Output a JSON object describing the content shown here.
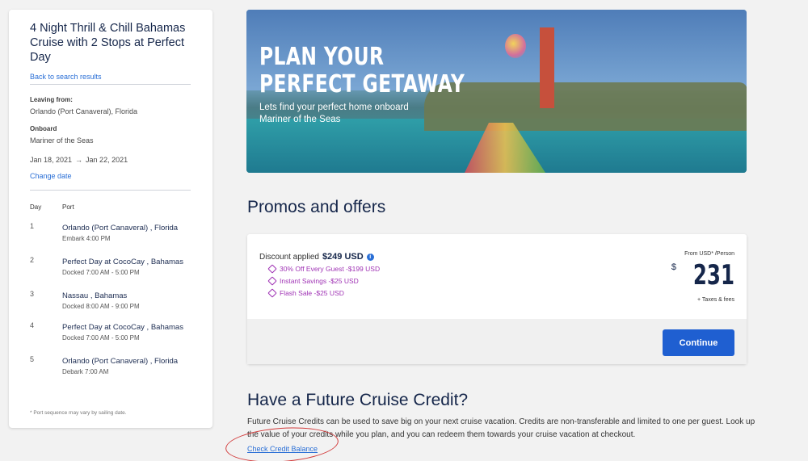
{
  "sidebar": {
    "title": "4 Night Thrill & Chill Bahamas Cruise with 2 Stops at Perfect Day",
    "back_link": "Back to search results",
    "leaving_label": "Leaving from:",
    "leaving_value": "Orlando (Port Canaveral), Florida",
    "onboard_label": "Onboard",
    "onboard_value": "Mariner of the Seas",
    "start_date": "Jan 18, 2021",
    "end_date": "Jan 22, 2021",
    "change_date": "Change date",
    "col_day": "Day",
    "col_port": "Port",
    "itinerary": [
      {
        "day": "1",
        "port": "Orlando (Port Canaveral) , Florida",
        "detail": "Embark 4:00 PM"
      },
      {
        "day": "2",
        "port": "Perfect Day at CocoCay , Bahamas",
        "detail": "Docked 7:00 AM - 5:00 PM"
      },
      {
        "day": "3",
        "port": "Nassau , Bahamas",
        "detail": "Docked 8:00 AM - 9:00 PM"
      },
      {
        "day": "4",
        "port": "Perfect Day at CocoCay , Bahamas",
        "detail": "Docked 7:00 AM - 5:00 PM"
      },
      {
        "day": "5",
        "port": "Orlando (Port Canaveral) , Florida",
        "detail": "Debark 7:00 AM"
      }
    ],
    "footnote": "* Port sequence may vary by sailing date."
  },
  "hero": {
    "headline_line1": "PLAN YOUR",
    "headline_line2": "PERFECT GETAWAY",
    "subtitle": "Lets find your perfect home onboard Mariner of the Seas"
  },
  "promos": {
    "title": "Promos and offers",
    "discount_label": "Discount applied",
    "discount_amount": "$249 USD",
    "offers": [
      "30% Off Every Guest  -$199 USD",
      "Instant Savings  -$25 USD",
      "Flash Sale  -$25 USD"
    ],
    "price_from": "From USD* /Person",
    "price_currency": "$",
    "price_amount": "231",
    "price_note": "+ Taxes & fees",
    "continue_label": "Continue"
  },
  "fcc": {
    "title": "Have a Future Cruise Credit?",
    "text": "Future Cruise Credits can be used to save big on your next cruise vacation. Credits are non-transferable and limited to one per guest. Look up the value of your credits while you plan, and you can redeem them towards your cruise vacation at checkout.",
    "link": "Check Credit Balance"
  },
  "colors": {
    "accent": "#1f5fd1",
    "link": "#2a6fd6",
    "offer": "#a034b5",
    "annotation": "#d23a3a"
  }
}
